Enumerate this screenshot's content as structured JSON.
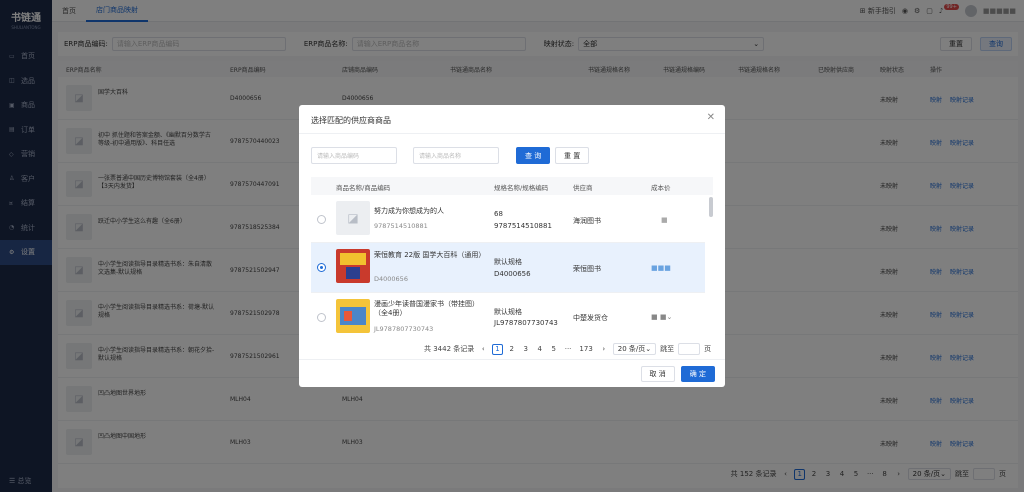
{
  "app": {
    "name": "书链通",
    "subtitle": "SHULIANTONG"
  },
  "sidebar": {
    "items": [
      {
        "label": "首页",
        "icon": "monitor-icon"
      },
      {
        "label": "选品",
        "icon": "basket-icon"
      },
      {
        "label": "商品",
        "icon": "box-icon"
      },
      {
        "label": "订单",
        "icon": "order-icon"
      },
      {
        "label": "营销",
        "icon": "tag-icon"
      },
      {
        "label": "客户",
        "icon": "user-icon"
      },
      {
        "label": "结算",
        "icon": "money-icon"
      },
      {
        "label": "统计",
        "icon": "chart-icon"
      },
      {
        "label": "设置",
        "icon": "gear-icon"
      }
    ],
    "collapse": "总览"
  },
  "topbar": {
    "tabs": [
      "首页",
      "店门商品映射"
    ],
    "guide": "新手指引",
    "badge": "99+",
    "username": "■■■■■"
  },
  "filter": {
    "erp_code_label": "ERP商品编码:",
    "erp_code_ph": "请输入ERP商品编码",
    "erp_name_label": "ERP商品名称:",
    "erp_name_ph": "请输入ERP商品名称",
    "status_label": "映射状态:",
    "status_value": "全部",
    "reset": "重置",
    "search": "查询"
  },
  "table": {
    "headers": [
      "ERP商品名称",
      "ERP商品编码",
      "店铺商品编码",
      "书链通商品名称",
      "书链通规格名称",
      "书链通规格编码",
      "书链通规格名称",
      "已映射供应商",
      "映射状态",
      "操作"
    ],
    "rows": [
      {
        "name": "国学大百科",
        "erp": "D4000656",
        "shop": "D4000656",
        "status": "未映射"
      },
      {
        "name": "初中 抓住题和答案金额、《幽默百分数学古等级-初中通用版》、科目任选",
        "erp": "9787570440023",
        "shop": "",
        "status": "未映射"
      },
      {
        "name": "一张票普通中国历史博物馆套装（全4册）【3天内发货】",
        "erp": "9787570447091",
        "shop": "",
        "status": "未映射"
      },
      {
        "name": "跃迁中小学生这么有趣（全6册）",
        "erp": "9787518525384",
        "shop": "",
        "status": "未映射"
      },
      {
        "name": "中小学生阅读指导目录精选书系：朱自清散文选集-默认规格",
        "erp": "9787521502947",
        "shop": "",
        "status": "未映射"
      },
      {
        "name": "中小学生阅读指导目录精选书系：荷塘-默认规格",
        "erp": "9787521502978",
        "shop": "",
        "status": "未映射"
      },
      {
        "name": "中小学生阅读指导目录精选书系：朝花夕拾-默认规格",
        "erp": "9787521502961",
        "shop": "",
        "status": "未映射"
      },
      {
        "name": "凹凸地图世界地形",
        "erp": "MLH04",
        "shop": "MLH04",
        "status": "未映射"
      },
      {
        "name": "凹凸地图中国地形",
        "erp": "MLH03",
        "shop": "MLH03",
        "status": "未映射"
      }
    ],
    "op_map": "映射",
    "op_log": "映射记录",
    "pager": {
      "total": "共 152 条记录",
      "pages": [
        "1",
        "2",
        "3",
        "4",
        "5",
        "···",
        "8"
      ],
      "size": "20 条/页",
      "goto": "跳至",
      "page_unit": "页"
    }
  },
  "modal": {
    "title": "选择匹配的供应商商品",
    "code_ph": "请输入商品编码",
    "name_ph": "请输入商品名称",
    "search": "查 询",
    "reset": "重 置",
    "headers": [
      "商品名称/商品编码",
      "规格名称/规格编码",
      "供应商",
      "成本价"
    ],
    "rows": [
      {
        "name": "努力成为你想成为的人",
        "code": "9787514510881",
        "spec": "68",
        "spec_code": "9787514510881",
        "supplier": "海润图书",
        "price": "■",
        "selected": false
      },
      {
        "name": "荣恒教育 22版 国学大百科（通用）",
        "code": "D4000656",
        "spec": "默认规格",
        "spec_code": "D4000656",
        "supplier": "荣恒图书",
        "price": "■■■",
        "selected": true
      },
      {
        "name": "漫画少年读普国漫家书（带挂图）（全4册）",
        "code": "JL9787807730743",
        "spec": "默认规格",
        "spec_code": "JL9787807730743",
        "supplier": "中楚发货仓",
        "price": "■ ■⌄",
        "selected": false
      }
    ],
    "pager": {
      "total": "共 3442 条记录",
      "pages": [
        "1",
        "2",
        "3",
        "4",
        "5",
        "···",
        "173"
      ],
      "size": "20 条/页",
      "goto": "跳至",
      "page_unit": "页"
    },
    "cancel": "取 消",
    "ok": "确 定"
  }
}
